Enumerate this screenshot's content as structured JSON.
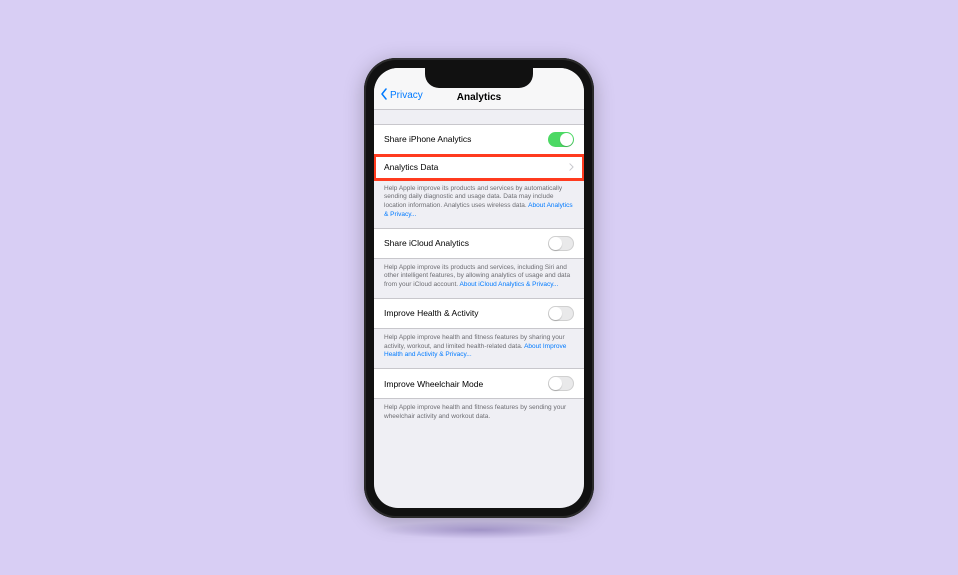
{
  "nav": {
    "back_label": "Privacy",
    "title": "Analytics"
  },
  "rows": {
    "share_iphone": {
      "label": "Share iPhone Analytics"
    },
    "analytics_data": {
      "label": "Analytics Data"
    },
    "share_icloud": {
      "label": "Share iCloud Analytics"
    },
    "improve_health": {
      "label": "Improve Health & Activity"
    },
    "improve_wheelchair": {
      "label": "Improve Wheelchair Mode"
    }
  },
  "footers": {
    "iphone": {
      "text": "Help Apple improve its products and services by automatically sending daily diagnostic and usage data. Data may include location information. Analytics uses wireless data. ",
      "link": "About Analytics & Privacy..."
    },
    "icloud": {
      "text": "Help Apple improve its products and services, including Siri and other intelligent features, by allowing analytics of usage and data from your iCloud account. ",
      "link": "About iCloud Analytics & Privacy..."
    },
    "health": {
      "text": "Help Apple improve health and fitness features by sharing your activity, workout, and limited health-related data. ",
      "link": "About Improve Health and Activity & Privacy..."
    },
    "wheelchair": {
      "text": "Help Apple improve health and fitness features by sending your wheelchair activity and workout data.",
      "link": ""
    }
  }
}
